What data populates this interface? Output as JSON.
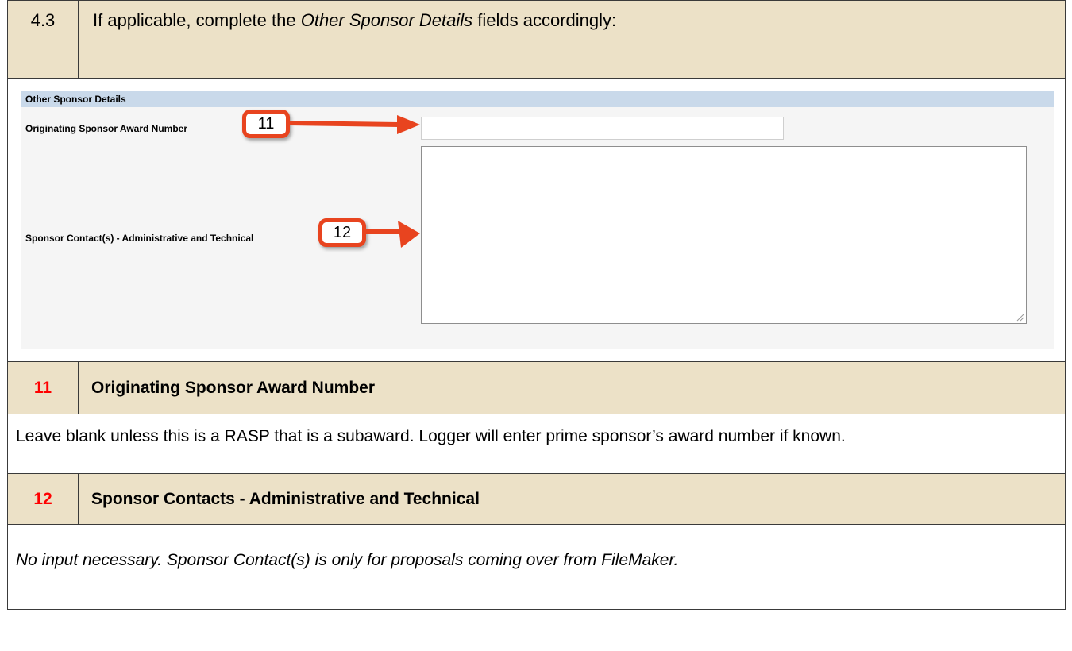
{
  "step": {
    "number": "4.3",
    "text_prefix": "If applicable, complete the ",
    "text_italic": "Other Sponsor Details",
    "text_suffix": " fields accordingly:"
  },
  "screenshot": {
    "section_header": "Other Sponsor Details",
    "field_award_label": "Originating Sponsor Award Number",
    "field_award_value": "",
    "field_contacts_label": "Sponsor Contact(s) - Administrative and Technical",
    "field_contacts_value": "",
    "callout_11": "11",
    "callout_12": "12",
    "callout_color": "#e8441f",
    "header_color": "#c9d9ea"
  },
  "items": [
    {
      "number": "11",
      "title": "Originating Sponsor Award Number",
      "description": "Leave blank unless this is a RASP that is a subaward. Logger will enter prime sponsor’s award number if known."
    },
    {
      "number": "12",
      "title": "Sponsor Contacts - Administrative and Technical",
      "description": "No input necessary. Sponsor Contact(s) is only for proposals coming over from FileMaker."
    }
  ],
  "colors": {
    "tan_row": "#ece1c7",
    "item_number": "#ff0000"
  }
}
